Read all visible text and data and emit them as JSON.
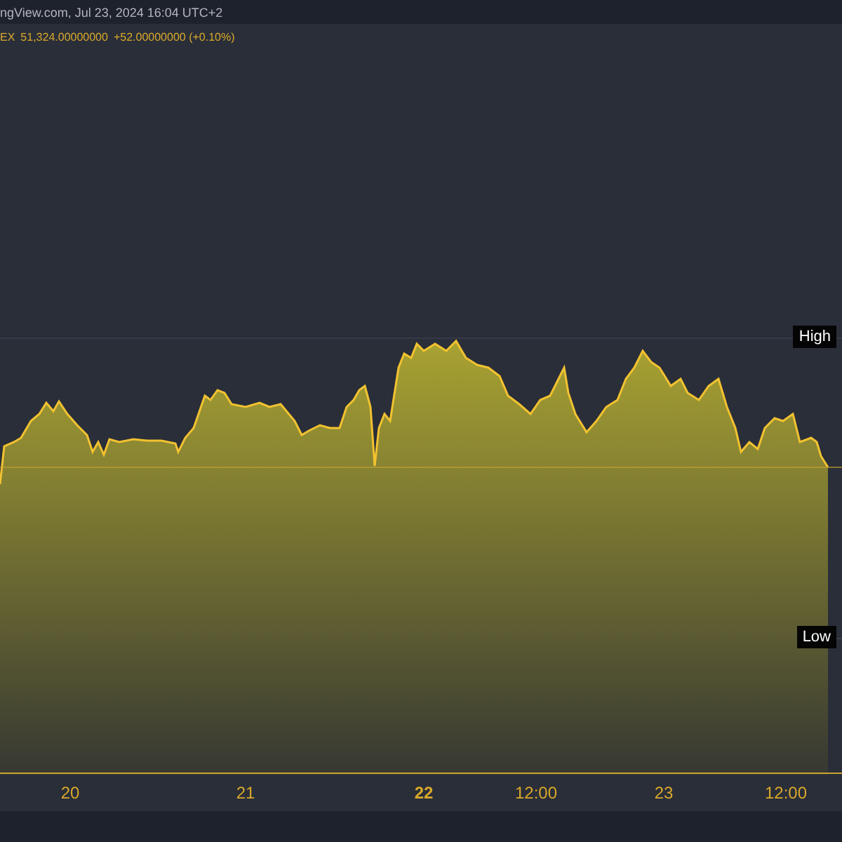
{
  "header": {
    "source_line": "ngView.com, Jul 23, 2024 16:04 UTC+2"
  },
  "quote": {
    "symbol": "EX",
    "price": "51,324.00000000",
    "change": "+52.00000000 (+0.10%)"
  },
  "chart": {
    "high_label": "High",
    "low_label": "Low"
  },
  "x_axis": [
    {
      "label": "20",
      "bold": false
    },
    {
      "label": "21",
      "bold": false
    },
    {
      "label": "22",
      "bold": true
    },
    {
      "label": "12:00",
      "bold": false
    },
    {
      "label": "23",
      "bold": false
    },
    {
      "label": "12:00",
      "bold": false
    }
  ]
}
